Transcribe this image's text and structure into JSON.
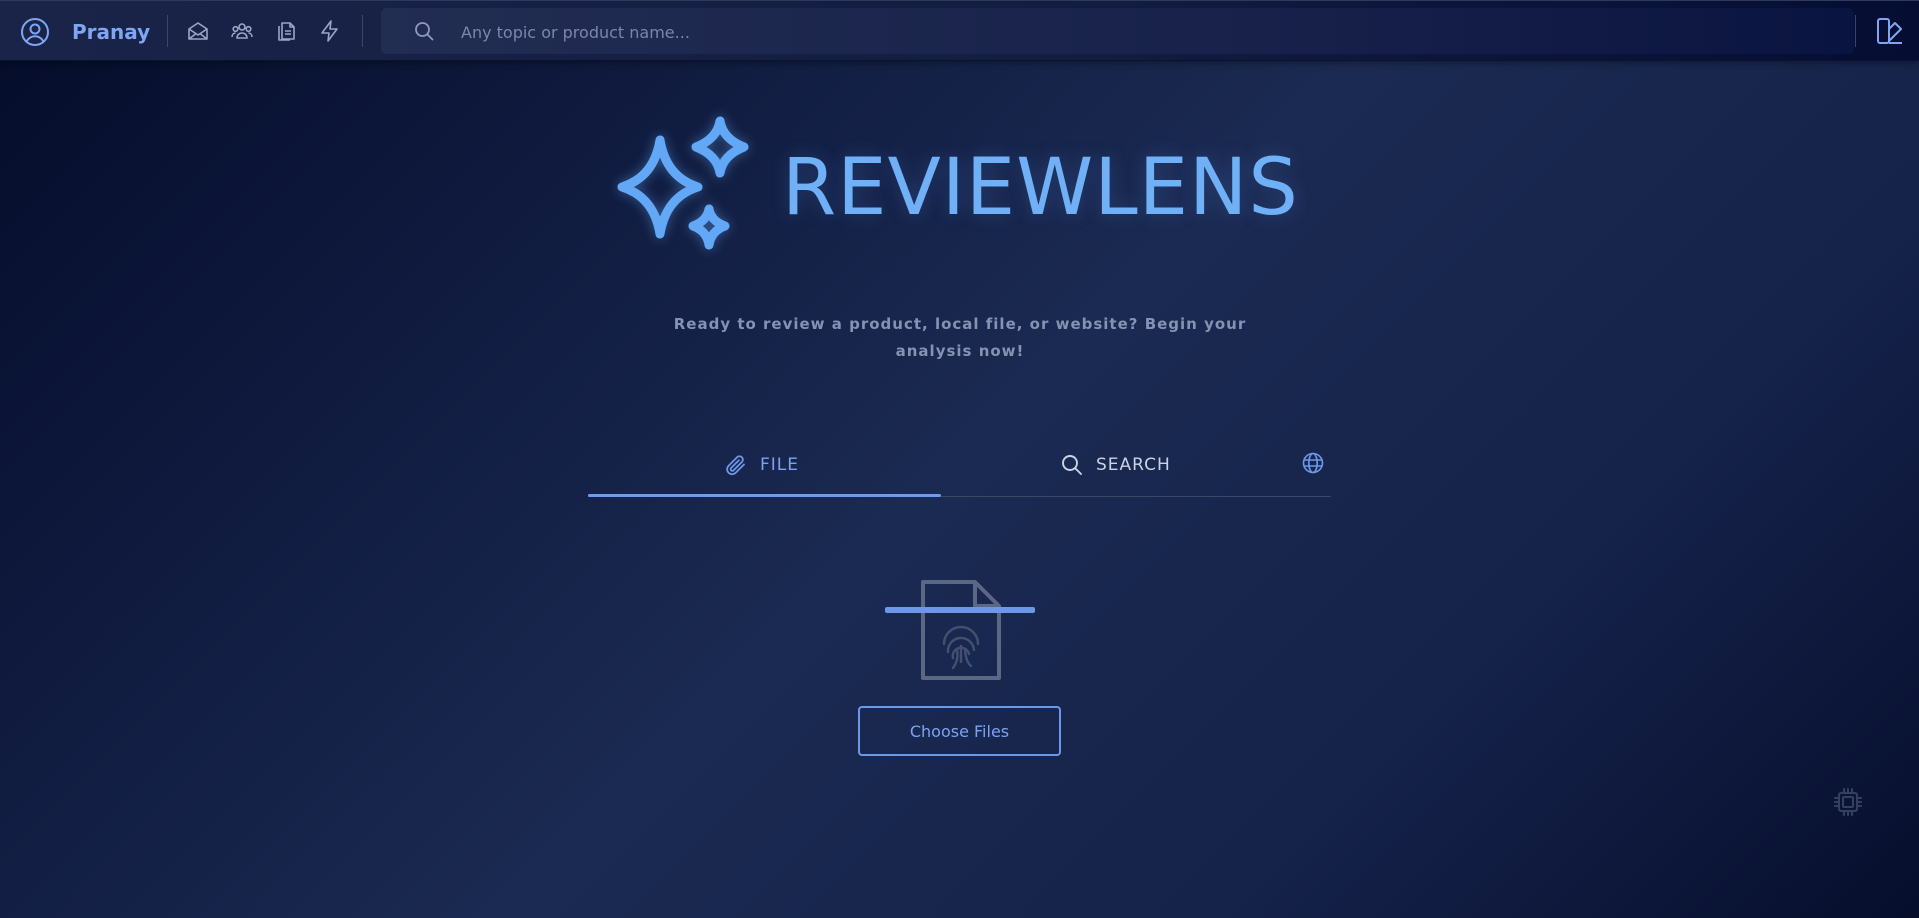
{
  "topbar": {
    "user_name": "Pranay",
    "icons": [
      "user-circle-icon",
      "mail-open-icon",
      "users-icon",
      "clipboard-copy-icon",
      "lightning-icon",
      "search-icon",
      "sidebar-layout-icon"
    ],
    "search": {
      "placeholder": "Any topic or product name..."
    }
  },
  "hero": {
    "app_name": "REVIEWLENS",
    "logo_icon": "sparkles-icon",
    "tagline": "Ready to review a product, local file, or website? Begin your analysis now!"
  },
  "tabs": {
    "items": [
      {
        "label": "FILE",
        "icon": "paperclip-icon",
        "active": true
      },
      {
        "label": "SEARCH",
        "icon": "search-icon",
        "active": false
      }
    ],
    "extra_icon": "globe-icon"
  },
  "upload": {
    "illustration": "file-fingerprint-scan-icon",
    "button_label": "Choose Files"
  },
  "footer": {
    "chip_icon": "cpu-chip-icon"
  },
  "colors": {
    "accent": "#6d9bf0",
    "logo": "#6fb0f6",
    "muted_text": "#8592b2",
    "background": "#0f1a3e"
  }
}
